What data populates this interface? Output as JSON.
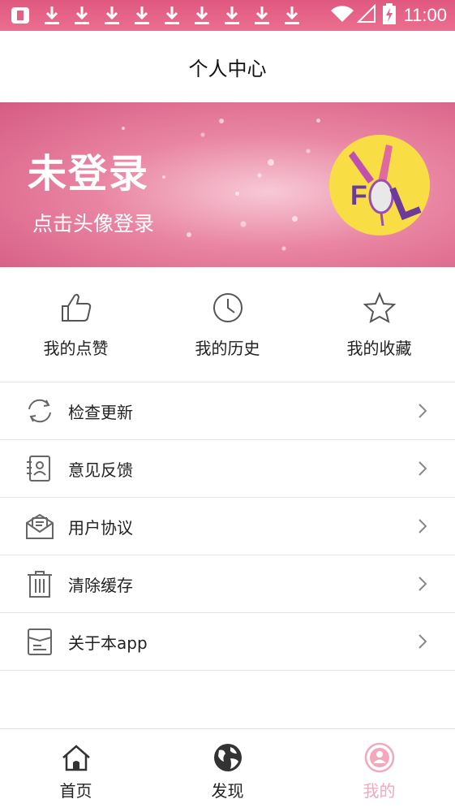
{
  "status_bar": {
    "time": "11:00",
    "icons": [
      "notification-icon",
      "download-icon",
      "wifi-icon",
      "signal-icon",
      "battery-icon"
    ]
  },
  "header": {
    "title": "个人中心"
  },
  "banner": {
    "title": "未登录",
    "subtitle": "点击头像登录",
    "avatar_text": "FL"
  },
  "quick_actions": [
    {
      "label": "我的点赞",
      "icon": "thumbs-up-icon"
    },
    {
      "label": "我的历史",
      "icon": "clock-icon"
    },
    {
      "label": "我的收藏",
      "icon": "star-icon"
    }
  ],
  "menu": [
    {
      "label": "检查更新",
      "icon": "refresh-icon"
    },
    {
      "label": "意见反馈",
      "icon": "feedback-icon"
    },
    {
      "label": "用户协议",
      "icon": "envelope-icon"
    },
    {
      "label": "清除缓存",
      "icon": "trash-icon"
    },
    {
      "label": "关于本app",
      "icon": "document-icon"
    }
  ],
  "bottom_nav": [
    {
      "label": "首页",
      "icon": "home-icon",
      "active": false
    },
    {
      "label": "发现",
      "icon": "globe-icon",
      "active": false
    },
    {
      "label": "我的",
      "icon": "user-icon",
      "active": true
    }
  ],
  "colors": {
    "status_bar": "#e65f85",
    "active_tab": "#f2a8bd",
    "icon_gray": "#555555",
    "avatar_bg": "#f9dd45"
  }
}
